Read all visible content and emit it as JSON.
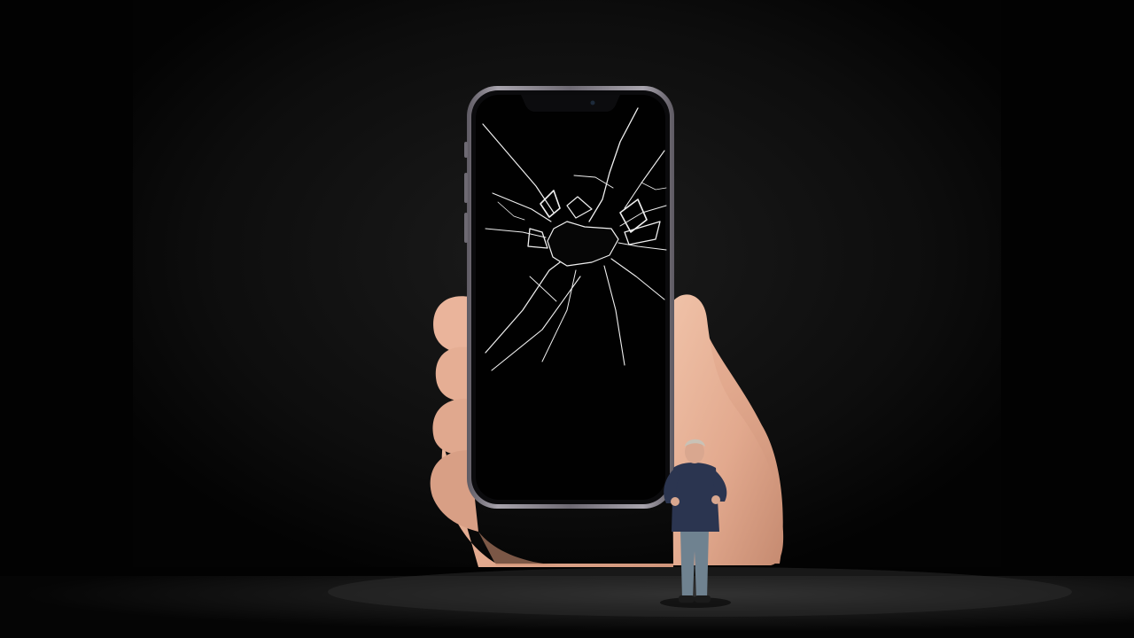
{
  "scene": {
    "description_free": true,
    "colors": {
      "background": "#020202",
      "screen_backdrop": "#141414",
      "stage_floor": "#1a1a1a",
      "skin": "#e8b39a",
      "skin_shadow": "#b97c63",
      "phone_frame": "#8a8690",
      "phone_screen": "#010101",
      "crack": "#f2f2f2",
      "presenter_shirt": "#2b3550",
      "presenter_jeans": "#6f8290"
    },
    "icons": {
      "phone": "smartphone-icon",
      "crack": "shattered-glass-icon",
      "presenter": "person-icon"
    }
  }
}
